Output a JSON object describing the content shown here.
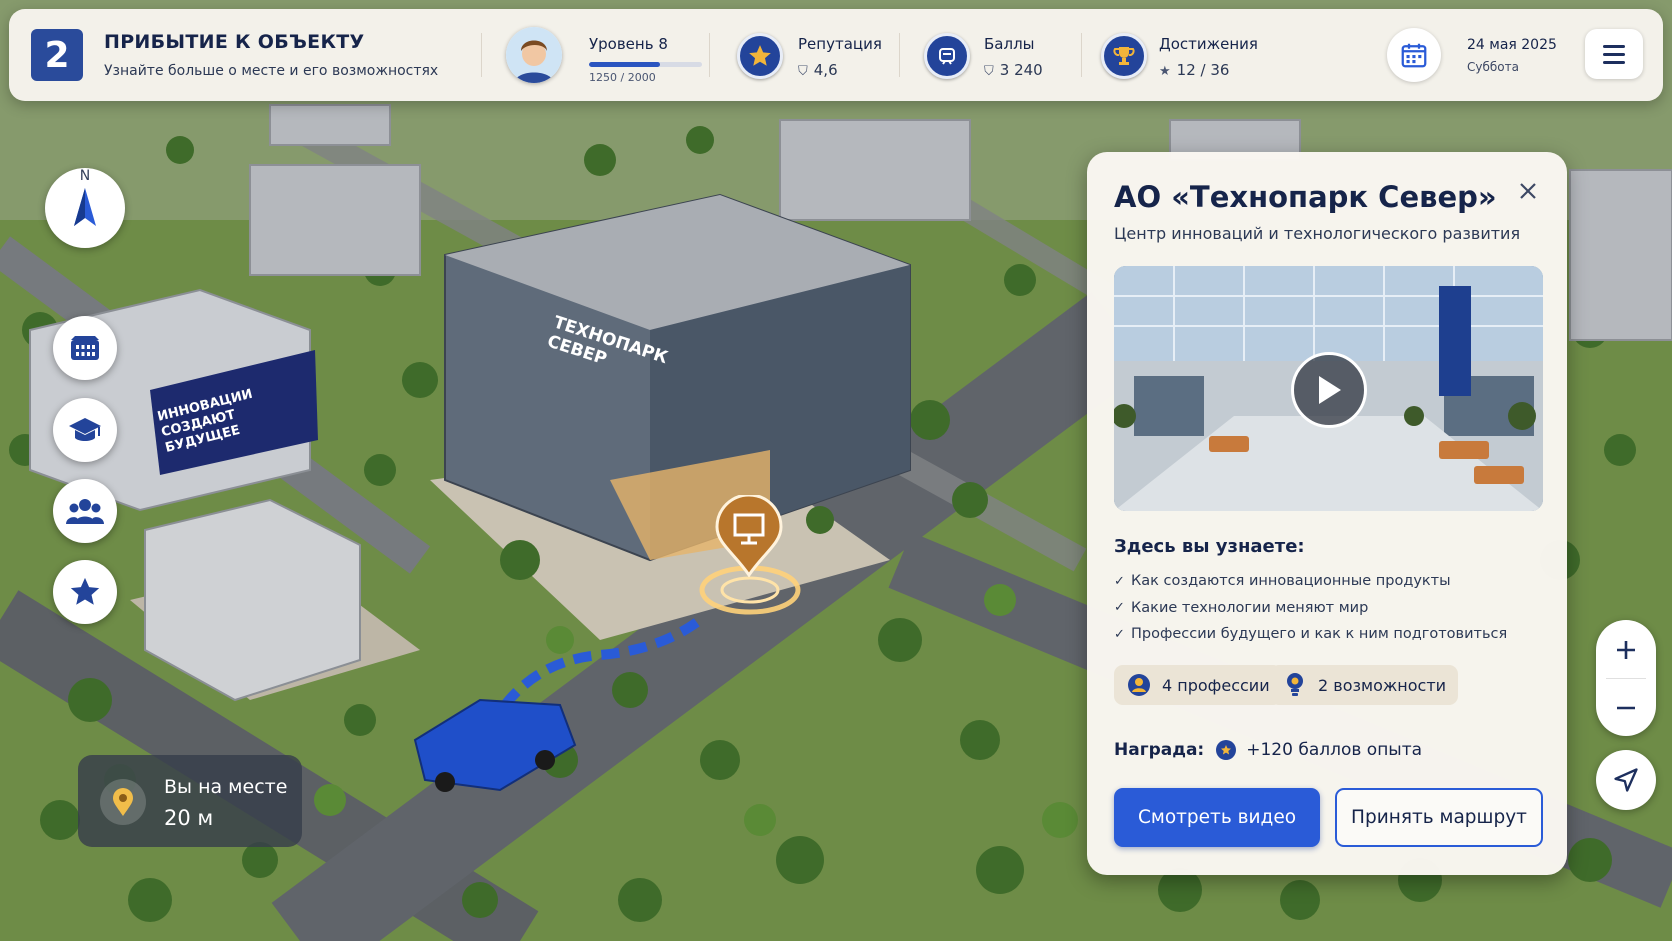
{
  "header": {
    "step_number": "2",
    "step_title": "ПРИБЫТИЕ К ОБЪЕКТУ",
    "step_subtitle": "Узнайте больше о месте и его возможностях",
    "level_label": "Уровень 8",
    "level_xp": "1250 / 2000",
    "level_progress": 0.625,
    "reputation_label": "Репутация",
    "reputation_value": "4,6",
    "points_label": "Баллы",
    "points_value": "3 240",
    "achievements_label": "Достижения",
    "achievements_value": "12 / 36",
    "date": "24 мая 2025",
    "weekday": "Суббота"
  },
  "map": {
    "building_sign": "ТЕХНОПАРК СЕВЕР",
    "billboard_text": "ИННОВАЦИИ СОЗДАЮТ БУДУЩЕЕ",
    "compass_label": "N",
    "location_status": "Вы на месте",
    "distance": "20 м"
  },
  "panel": {
    "title": "АО «Технопарк Север»",
    "subtitle": "Центр инноваций и технологического развития",
    "learn_heading": "Здесь вы узнаете:",
    "learn_items": [
      "Как создаются инновационные продукты",
      "Какие технологии меняют мир",
      "Профессии будущего и как к ним подготовиться"
    ],
    "chip_professions": "4 профессии",
    "chip_opportunities": "2 возможности",
    "reward_label": "Награда:",
    "reward_value": "+120 баллов опыта",
    "primary_button": "Смотреть видео",
    "secondary_button": "Принять маршрут"
  },
  "colors": {
    "accent": "#2a5bd7",
    "navy": "#23449a",
    "panel_bg": "#f9f6f1"
  }
}
